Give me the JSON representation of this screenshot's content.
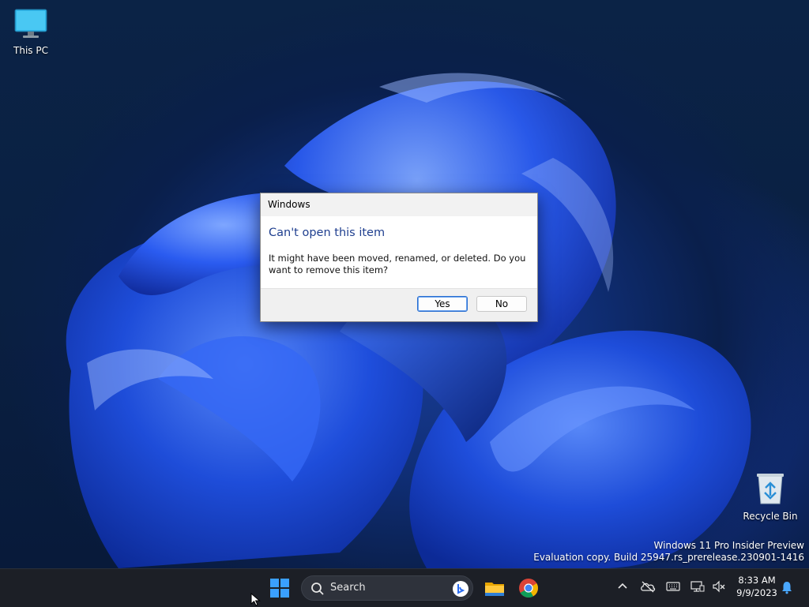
{
  "desktop": {
    "icons": [
      {
        "label": "This PC"
      },
      {
        "label": "Recycle Bin"
      }
    ],
    "watermark": {
      "line1": "Windows 11 Pro Insider Preview",
      "line2": "Evaluation copy. Build 25947.rs_prerelease.230901-1416"
    }
  },
  "dialog": {
    "title": "Windows",
    "heading": "Can't open this item",
    "message": "It might have been moved, renamed, or deleted. Do you want to remove this item?",
    "yes_label": "Yes",
    "no_label": "No"
  },
  "taskbar": {
    "search_placeholder": "Search",
    "apps": [
      "windows-start-icon",
      "file-explorer-icon",
      "chrome-icon"
    ],
    "tray": [
      "chevron-up-icon",
      "onedrive-offline-icon",
      "keyboard-icon",
      "network-icon",
      "volume-muted-icon",
      "notification-bell-icon"
    ],
    "time": "8:33 AM",
    "date": "9/9/2023"
  },
  "colors": {
    "accent": "#1f3f8f",
    "taskbar_bg": "#1c1f26",
    "dialog_footer": "#f0f0f0"
  }
}
